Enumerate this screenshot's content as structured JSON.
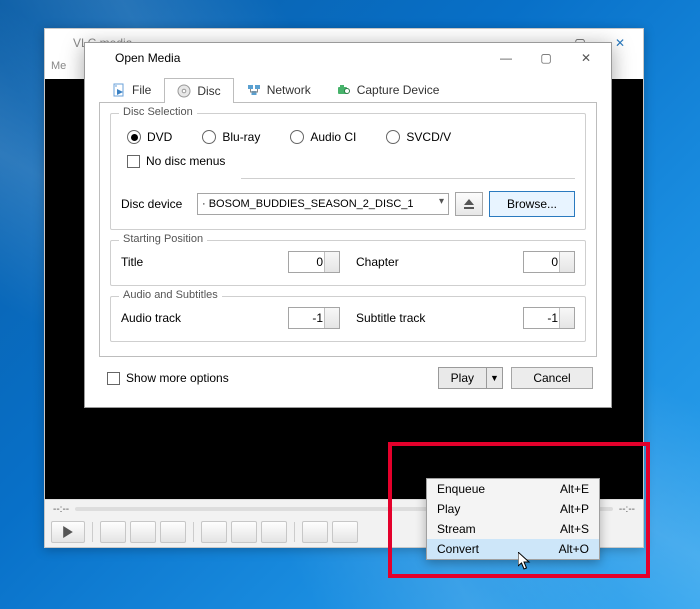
{
  "desktop": {},
  "vlc_main": {
    "title": "VLC media...",
    "menu_me": "Me",
    "controls": {
      "time_left": "--:--",
      "time_right": "--:--"
    }
  },
  "dialog": {
    "title": "Open Media",
    "window_buttons": {
      "minimize": "—",
      "maximize": "▢",
      "close": "✕"
    },
    "tabs": {
      "file": "File",
      "disc": "Disc",
      "network": "Network",
      "capture": "Capture Device"
    },
    "disc_selection": {
      "legend": "Disc Selection",
      "options": {
        "dvd": "DVD",
        "bluray": "Blu-ray",
        "audiocd": "Audio CI",
        "svcd": "SVCD/V"
      },
      "no_menus": "No disc menus",
      "device_label": "Disc device",
      "device_value": "· BOSOM_BUDDIES_SEASON_2_DISC_1",
      "browse": "Browse..."
    },
    "starting_position": {
      "legend": "Starting Position",
      "title_label": "Title",
      "title_value": "0",
      "chapter_label": "Chapter",
      "chapter_value": "0"
    },
    "audio_subs": {
      "legend": "Audio and Subtitles",
      "audio_label": "Audio track",
      "audio_value": "-1",
      "sub_label": "Subtitle track",
      "sub_value": "-1"
    },
    "show_more": "Show more options",
    "play_button": "Play",
    "cancel_button": "Cancel",
    "menu": {
      "enqueue": {
        "label": "Enqueue",
        "accel": "Alt+E"
      },
      "play": {
        "label": "Play",
        "accel": "Alt+P"
      },
      "stream": {
        "label": "Stream",
        "accel": "Alt+S"
      },
      "convert": {
        "label": "Convert",
        "accel": "Alt+O"
      }
    }
  }
}
